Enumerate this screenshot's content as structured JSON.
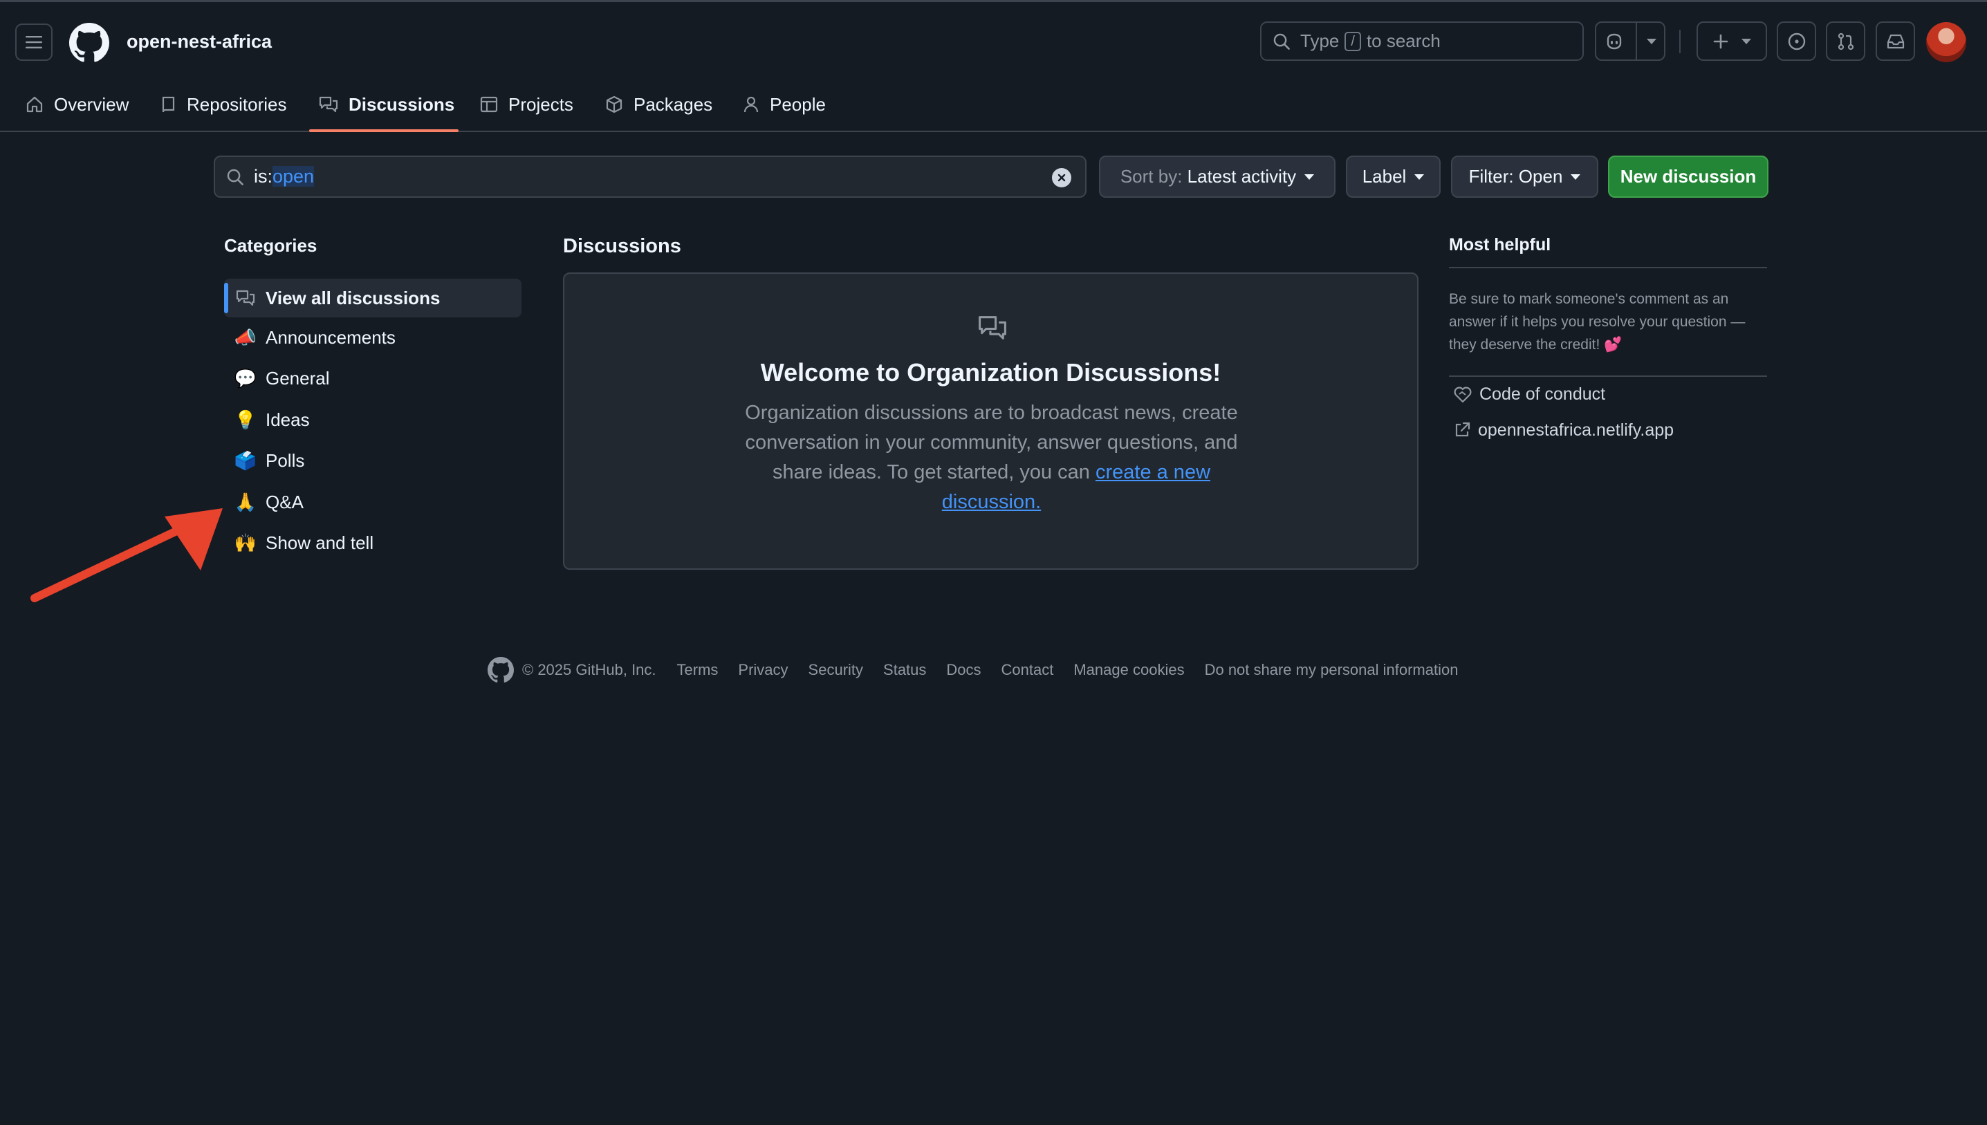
{
  "header": {
    "org_name": "open-nest-africa",
    "search_placeholder_prefix": "Type",
    "search_shortcut": "/",
    "search_placeholder_suffix": "to search"
  },
  "nav": {
    "tabs": [
      {
        "label": "Overview",
        "icon": "home-icon"
      },
      {
        "label": "Repositories",
        "icon": "repo-icon"
      },
      {
        "label": "Discussions",
        "icon": "comment-discussion-icon",
        "selected": true
      },
      {
        "label": "Projects",
        "icon": "table-icon"
      },
      {
        "label": "Packages",
        "icon": "package-icon"
      },
      {
        "label": "People",
        "icon": "person-icon"
      }
    ]
  },
  "filter_bar": {
    "query_prefix": "is:",
    "query_value": "open",
    "sort_label": "Sort by:",
    "sort_value": "Latest activity",
    "label_button": "Label",
    "filter_button": "Filter: Open",
    "new_discussion": "New discussion"
  },
  "categories": {
    "title": "Categories",
    "items": [
      {
        "label": "View all discussions",
        "icon": "comment-discussion-icon",
        "active": true
      },
      {
        "label": "Announcements",
        "emoji": "📣"
      },
      {
        "label": "General",
        "emoji": "💬"
      },
      {
        "label": "Ideas",
        "emoji": "💡"
      },
      {
        "label": "Polls",
        "emoji": "🗳️"
      },
      {
        "label": "Q&A",
        "emoji": "🙏"
      },
      {
        "label": "Show and tell",
        "emoji": "🙌"
      }
    ]
  },
  "discussions": {
    "title": "Discussions",
    "empty_title": "Welcome to Organization Discussions!",
    "empty_body": "Organization discussions are to broadcast news, create conversation in your community, answer questions, and share ideas. To get started, you can",
    "empty_link": "create a new discussion."
  },
  "most_helpful": {
    "title": "Most helpful",
    "text": "Be sure to mark someone's comment as an answer if it helps you resolve your question — they deserve the credit! 💕",
    "links": [
      {
        "label": "Code of conduct",
        "icon": "code-of-conduct-icon"
      },
      {
        "label": "opennestafrica.netlify.app",
        "icon": "link-external-icon"
      }
    ]
  },
  "footer": {
    "copyright": "© 2025 GitHub, Inc.",
    "links": [
      "Terms",
      "Privacy",
      "Security",
      "Status",
      "Docs",
      "Contact",
      "Manage cookies",
      "Do not share my personal information"
    ]
  },
  "colors": {
    "background": "#151b23",
    "accent_link": "#4493f8",
    "tab_underline": "#f78166",
    "primary_button": "#238636",
    "annotation_arrow": "#e8432d"
  }
}
